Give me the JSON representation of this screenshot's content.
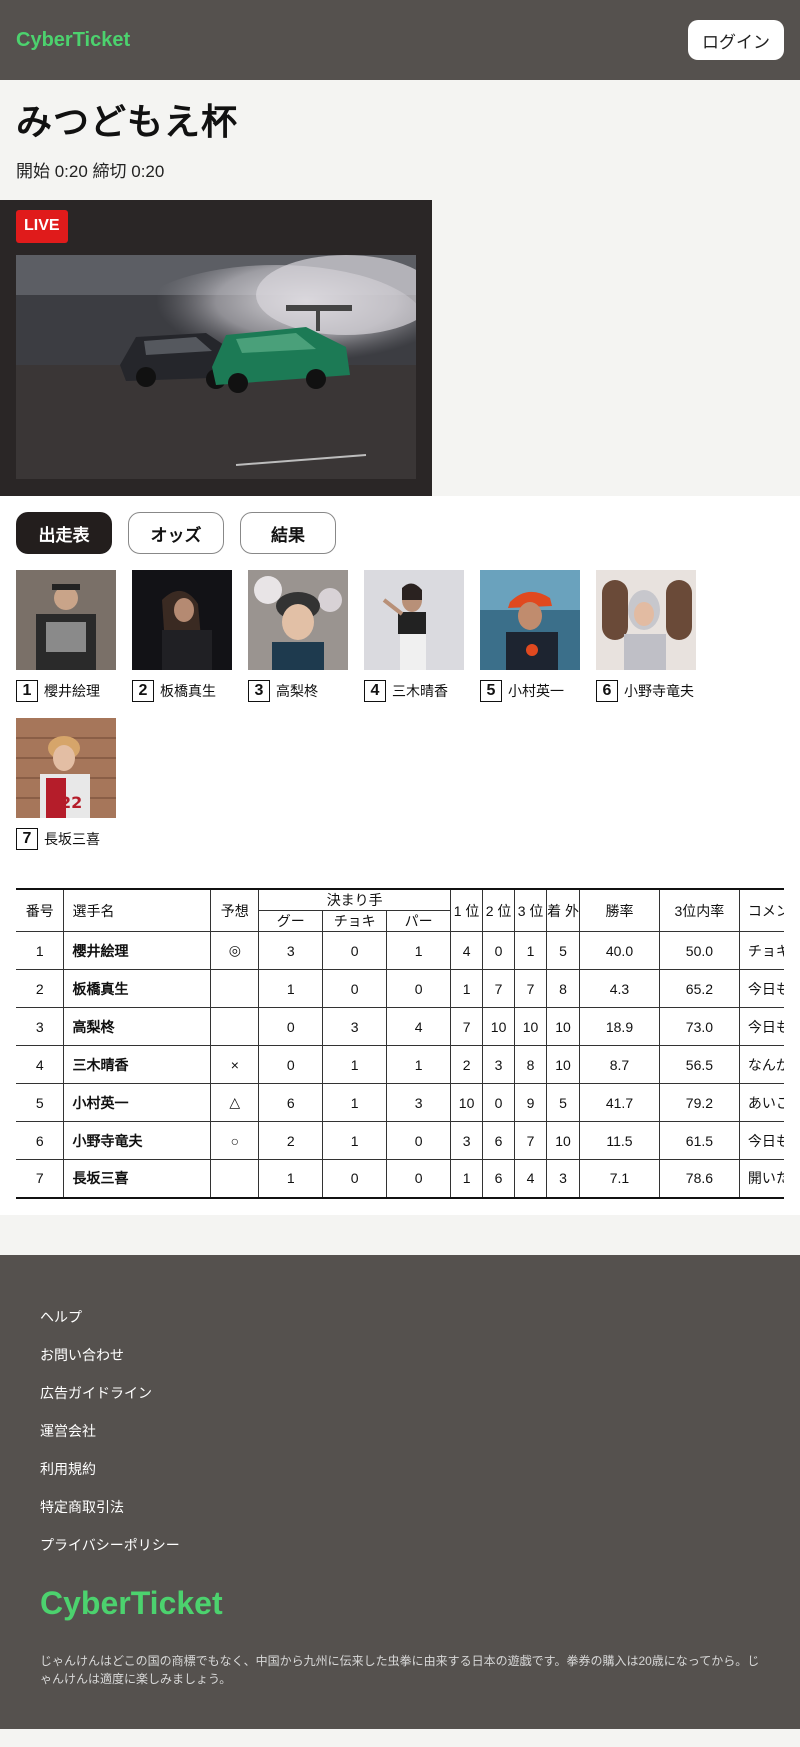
{
  "header": {
    "brand": "CyberTicket",
    "login_label": "ログイン"
  },
  "event": {
    "title": "みつどもえ杯",
    "time_text": "開始 0:20 締切 0:20"
  },
  "live": {
    "badge": "LIVE"
  },
  "tabs": [
    {
      "label": "出走表",
      "active": true
    },
    {
      "label": "オッズ",
      "active": false
    },
    {
      "label": "結果",
      "active": false
    }
  ],
  "players": [
    {
      "num": "1",
      "name": "櫻井絵理"
    },
    {
      "num": "2",
      "name": "板橋真生"
    },
    {
      "num": "3",
      "name": "高梨柊"
    },
    {
      "num": "4",
      "name": "三木晴香"
    },
    {
      "num": "5",
      "name": "小村英一"
    },
    {
      "num": "6",
      "name": "小野寺竜夫"
    },
    {
      "num": "7",
      "name": "長坂三喜"
    }
  ],
  "table": {
    "headers": {
      "num": "番号",
      "name": "選手名",
      "pred": "予想",
      "finisher": "決まり手",
      "goo": "グー",
      "choki": "チョキ",
      "paa": "パー",
      "first": "1 位",
      "second": "2 位",
      "third": "3 位",
      "out": "着 外",
      "winrate": "勝率",
      "top3rate": "3位内率",
      "comment": "コメント"
    },
    "rows": [
      {
        "num": "1",
        "name": "櫻井絵理",
        "pred": "◎",
        "goo": "3",
        "choki": "0",
        "paa": "1",
        "first": "4",
        "second": "0",
        "third": "1",
        "out": "5",
        "winrate": "40.0",
        "top3rate": "50.0",
        "comment": "チョキ"
      },
      {
        "num": "2",
        "name": "板橋真生",
        "pred": "",
        "goo": "1",
        "choki": "0",
        "paa": "0",
        "first": "1",
        "second": "7",
        "third": "7",
        "out": "8",
        "winrate": "4.3",
        "top3rate": "65.2",
        "comment": "今日も"
      },
      {
        "num": "3",
        "name": "高梨柊",
        "pred": "",
        "goo": "0",
        "choki": "3",
        "paa": "4",
        "first": "7",
        "second": "10",
        "third": "10",
        "out": "10",
        "winrate": "18.9",
        "top3rate": "73.0",
        "comment": "今日も"
      },
      {
        "num": "4",
        "name": "三木晴香",
        "pred": "×",
        "goo": "0",
        "choki": "1",
        "paa": "1",
        "first": "2",
        "second": "3",
        "third": "8",
        "out": "10",
        "winrate": "8.7",
        "top3rate": "56.5",
        "comment": "なんか"
      },
      {
        "num": "5",
        "name": "小村英一",
        "pred": "△",
        "goo": "6",
        "choki": "1",
        "paa": "3",
        "first": "10",
        "second": "0",
        "third": "9",
        "out": "5",
        "winrate": "41.7",
        "top3rate": "79.2",
        "comment": "あいこ"
      },
      {
        "num": "6",
        "name": "小野寺竜夫",
        "pred": "○",
        "goo": "2",
        "choki": "1",
        "paa": "0",
        "first": "3",
        "second": "6",
        "third": "7",
        "out": "10",
        "winrate": "11.5",
        "top3rate": "61.5",
        "comment": "今日も"
      },
      {
        "num": "7",
        "name": "長坂三喜",
        "pred": "",
        "goo": "1",
        "choki": "0",
        "paa": "0",
        "first": "1",
        "second": "6",
        "third": "4",
        "out": "3",
        "winrate": "7.1",
        "top3rate": "78.6",
        "comment": "開いた"
      }
    ]
  },
  "footer": {
    "links": [
      "ヘルプ",
      "お問い合わせ",
      "広告ガイドライン",
      "運営会社",
      "利用規約",
      "特定商取引法",
      "プライバシーポリシー"
    ],
    "brand": "CyberTicket",
    "note": "じゃんけんはどこの国の商標でもなく、中国から九州に伝来した虫拳に由来する日本の遊戯です。拳券の購入は20歳になってから。じゃんけんは適度に楽しみましょう。"
  }
}
